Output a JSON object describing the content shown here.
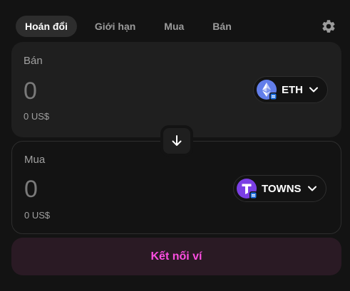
{
  "tabs": [
    {
      "label": "Hoán đổi",
      "active": true
    },
    {
      "label": "Giới hạn",
      "active": false
    },
    {
      "label": "Mua",
      "active": false
    },
    {
      "label": "Bán",
      "active": false
    }
  ],
  "settings_icon": "gear-icon",
  "sell": {
    "label": "Bán",
    "amount": "0",
    "usd": "0 US$",
    "token": {
      "symbol": "ETH",
      "icon": "ethereum-logo",
      "color": "#627eea"
    }
  },
  "switch_icon": "arrow-down-icon",
  "buy": {
    "label": "Mua",
    "amount": "0",
    "usd": "0 US$",
    "token": {
      "symbol": "TOWNS",
      "icon": "towns-logo",
      "color": "#7b3fe4"
    }
  },
  "connect_button": {
    "label": "Kết nối ví",
    "color": "#fc4ee1",
    "background": "#2a1a24"
  },
  "colors": {
    "background": "#131313",
    "panel": "#1f1f1f",
    "border": "#2e2e2e",
    "muted": "#a0a0a0"
  }
}
